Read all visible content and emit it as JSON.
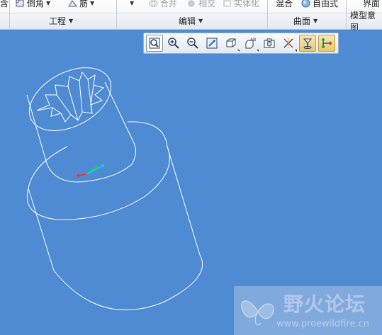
{
  "ribbon": {
    "row1": {
      "cut_left": "含",
      "round": "倒角",
      "rib": "筋",
      "merge": "合并",
      "intersect": "相交",
      "solidify": "实体化",
      "blend": "混合",
      "freestyle": "自由式",
      "interface": "界面"
    },
    "groups": {
      "engineering": "工程",
      "editing": "编辑",
      "surfaces": "曲面",
      "model_intent": "模型意图"
    }
  },
  "view_toolbar": {
    "buttons": [
      {
        "name": "refit-button",
        "icon": "refit-icon"
      },
      {
        "name": "zoom-in-button",
        "icon": "zoom-in-icon"
      },
      {
        "name": "zoom-out-button",
        "icon": "zoom-out-icon"
      },
      {
        "name": "repaint-button",
        "icon": "repaint-icon"
      },
      {
        "name": "display-style-button",
        "icon": "display-style-icon"
      },
      {
        "name": "saved-orientations-button",
        "icon": "saved-views-icon"
      },
      {
        "name": "view-manager-button",
        "icon": "camera-icon"
      },
      {
        "name": "datum-display-button",
        "icon": "datum-axes-icon"
      },
      {
        "name": "spin-center-button",
        "icon": "spin-center-icon"
      },
      {
        "name": "annotation-display-button",
        "icon": "annotation-icon"
      }
    ]
  },
  "watermark": {
    "title": "野火论坛",
    "url": "www.proewildfire.cn"
  },
  "colors": {
    "viewport": "#4f8bd3",
    "model_edges": "#ffffff"
  }
}
